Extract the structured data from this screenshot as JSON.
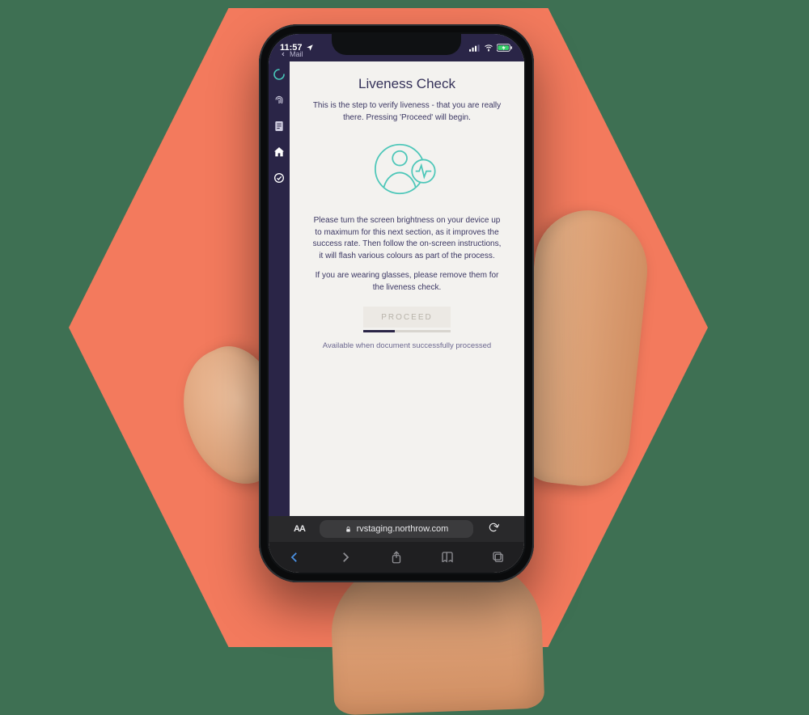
{
  "statusbar": {
    "time": "11:57",
    "back_app": "Mail"
  },
  "sidebar": {
    "items": [
      {
        "name": "spinner-icon"
      },
      {
        "name": "fingerprint-icon"
      },
      {
        "name": "document-icon"
      },
      {
        "name": "home-icon"
      },
      {
        "name": "checkmark-circle-icon"
      }
    ]
  },
  "screen": {
    "title": "Liveness Check",
    "intro": "This is the step to verify liveness - that you are really there. Pressing 'Proceed' will begin.",
    "paragraph1": "Please turn the screen brightness on your device up to maximum for this next section, as it improves the success rate. Then follow the on-screen instructions, it will flash various colours as part of the process.",
    "paragraph2": "If you are wearing glasses, please remove them for the liveness check.",
    "proceed_label": "PROCEED",
    "proceed_hint": "Available when document successfully processed"
  },
  "browser": {
    "text_size_label": "AA",
    "url": "rvstaging.northrow.com"
  }
}
